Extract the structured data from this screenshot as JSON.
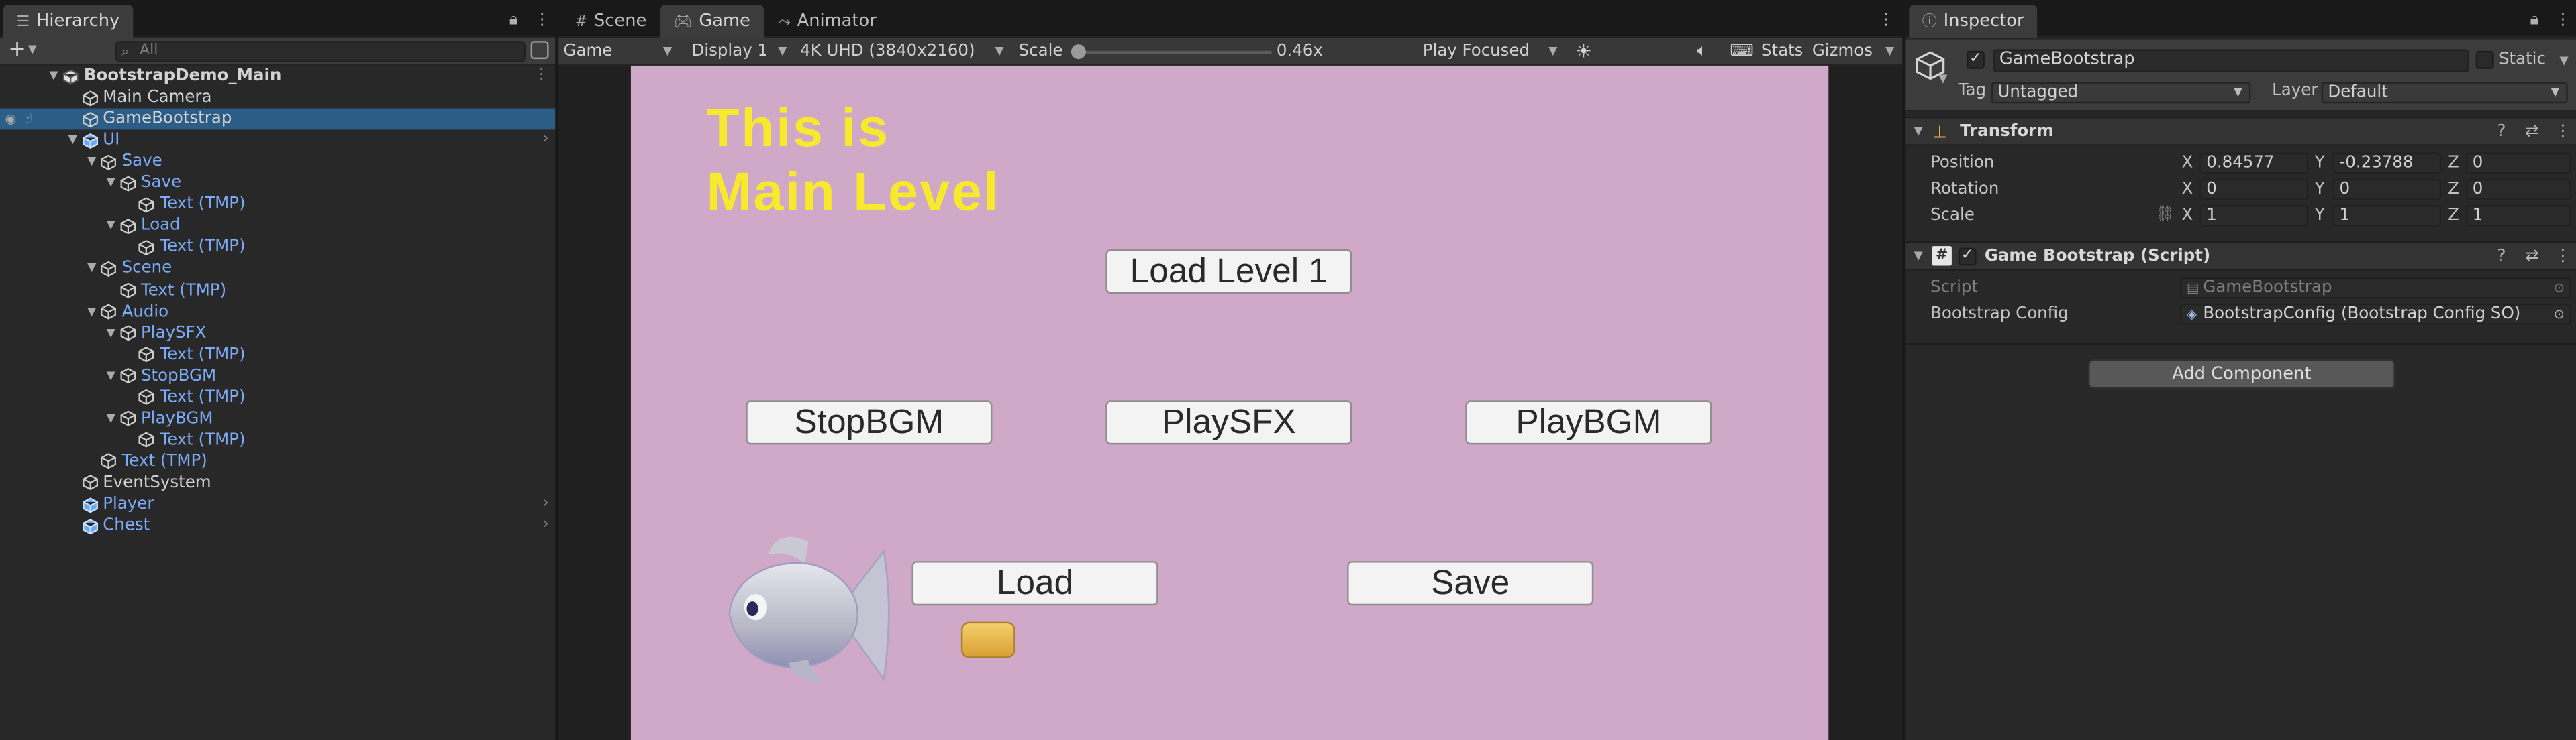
{
  "hierarchy": {
    "tab_label": "Hierarchy",
    "search_placeholder": "All",
    "rows": [
      {
        "label": "BootstrapDemo_Main",
        "depth": 0,
        "arrow": "down",
        "icon": "unity-logo-icon",
        "color": "white",
        "bold": true,
        "menu": true
      },
      {
        "label": "Main Camera",
        "depth": 1,
        "arrow": "",
        "icon": "cube-outline-icon",
        "color": "white"
      },
      {
        "label": "GameBootstrap",
        "depth": 1,
        "arrow": "",
        "icon": "cube-outline-icon",
        "color": "white",
        "selected": true
      },
      {
        "label": "UI",
        "depth": 1,
        "arrow": "down",
        "icon": "prefab-cube-icon",
        "color": "blue",
        "chevron": true
      },
      {
        "label": "Save",
        "depth": 2,
        "arrow": "down",
        "icon": "cube-outline-icon",
        "color": "blue"
      },
      {
        "label": "Save",
        "depth": 3,
        "arrow": "down",
        "icon": "cube-outline-icon",
        "color": "blue"
      },
      {
        "label": "Text (TMP)",
        "depth": 4,
        "arrow": "",
        "icon": "cube-outline-icon",
        "color": "blue"
      },
      {
        "label": "Load",
        "depth": 3,
        "arrow": "down",
        "icon": "cube-outline-icon",
        "color": "blue"
      },
      {
        "label": "Text (TMP)",
        "depth": 4,
        "arrow": "",
        "icon": "cube-outline-icon",
        "color": "blue"
      },
      {
        "label": "Scene",
        "depth": 2,
        "arrow": "down",
        "icon": "cube-outline-icon",
        "color": "blue"
      },
      {
        "label": "Text (TMP)",
        "depth": 3,
        "arrow": "",
        "icon": "cube-outline-icon",
        "color": "blue"
      },
      {
        "label": "Audio",
        "depth": 2,
        "arrow": "down",
        "icon": "cube-outline-icon",
        "color": "blue"
      },
      {
        "label": "PlaySFX",
        "depth": 3,
        "arrow": "down",
        "icon": "cube-outline-icon",
        "color": "blue"
      },
      {
        "label": "Text (TMP)",
        "depth": 4,
        "arrow": "",
        "icon": "cube-outline-icon",
        "color": "blue"
      },
      {
        "label": "StopBGM",
        "depth": 3,
        "arrow": "down",
        "icon": "cube-outline-icon",
        "color": "blue"
      },
      {
        "label": "Text (TMP)",
        "depth": 4,
        "arrow": "",
        "icon": "cube-outline-icon",
        "color": "blue"
      },
      {
        "label": "PlayBGM",
        "depth": 3,
        "arrow": "down",
        "icon": "cube-outline-icon",
        "color": "blue"
      },
      {
        "label": "Text (TMP)",
        "depth": 4,
        "arrow": "",
        "icon": "cube-outline-icon",
        "color": "blue"
      },
      {
        "label": "Text (TMP)",
        "depth": 2,
        "arrow": "",
        "icon": "cube-outline-icon",
        "color": "blue"
      },
      {
        "label": "EventSystem",
        "depth": 1,
        "arrow": "",
        "icon": "cube-outline-icon",
        "color": "white"
      },
      {
        "label": "Player",
        "depth": 1,
        "arrow": "",
        "icon": "prefab-cube-icon",
        "color": "blue",
        "chevron": true
      },
      {
        "label": "Chest",
        "depth": 1,
        "arrow": "",
        "icon": "prefab-cube-icon",
        "color": "blue",
        "chevron": true
      }
    ]
  },
  "center_tabs": [
    {
      "label": "Scene",
      "icon": "grid-icon"
    },
    {
      "label": "Game",
      "icon": "gamepad-icon",
      "active": true
    },
    {
      "label": "Animator",
      "icon": "animator-icon"
    }
  ],
  "game_toolbar": {
    "view_mode": "Game",
    "display": "Display 1",
    "resolution": "4K UHD (3840x2160)",
    "scale_label": "Scale",
    "scale_value": "0.46x",
    "scale_fraction": 0.0,
    "play_mode": "Play Focused",
    "stats": "Stats",
    "gizmos": "Gizmos"
  },
  "game": {
    "title_line1": "This is",
    "title_line2": "Main Level",
    "buttons": {
      "load_level": "Load Level 1",
      "stop_bgm": "StopBGM",
      "play_sfx": "PlaySFX",
      "play_bgm": "PlayBGM",
      "load": "Load",
      "save": "Save"
    },
    "colors": {
      "background": "#d0a8c8",
      "title": "#f7ea2c"
    }
  },
  "inspector": {
    "tab_label": "Inspector",
    "object_name": "GameBootstrap",
    "active": true,
    "static_label": "Static",
    "tag_label": "Tag",
    "tag_value": "Untagged",
    "layer_label": "Layer",
    "layer_value": "Default",
    "transform": {
      "title": "Transform",
      "position_label": "Position",
      "rotation_label": "Rotation",
      "scale_label": "Scale",
      "position": {
        "x": "0.84577",
        "y": "-0.23788",
        "z": "0"
      },
      "rotation": {
        "x": "0",
        "y": "0",
        "z": "0"
      },
      "scale": {
        "x": "1",
        "y": "1",
        "z": "1"
      }
    },
    "script_component": {
      "title": "Game Bootstrap (Script)",
      "script_label": "Script",
      "script_value": "GameBootstrap",
      "config_label": "Bootstrap Config",
      "config_value": "BootstrapConfig (Bootstrap Config SO)"
    },
    "add_component": "Add Component"
  },
  "axes": {
    "x": "X",
    "y": "Y",
    "z": "Z"
  }
}
